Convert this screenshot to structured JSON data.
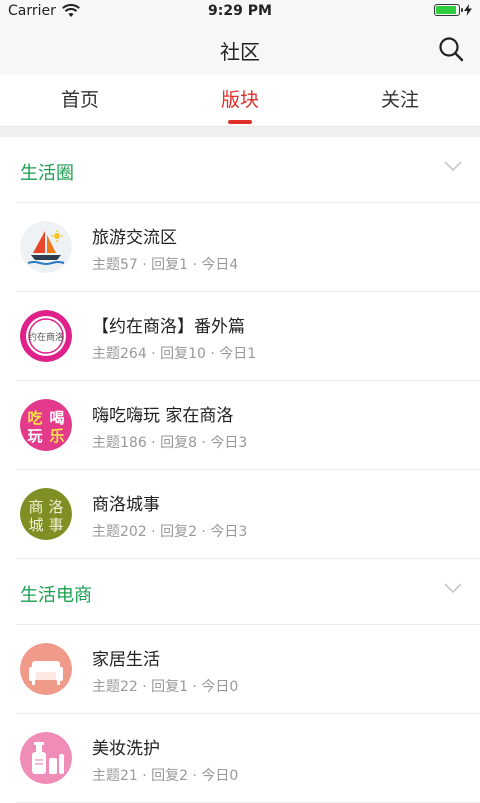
{
  "status_bar": {
    "carrier": "Carrier",
    "time": "9:29 PM",
    "battery_level": 1.0
  },
  "nav": {
    "title": "社区"
  },
  "tabs": [
    {
      "label": "首页",
      "active": false
    },
    {
      "label": "版块",
      "active": true
    },
    {
      "label": "关注",
      "active": false
    }
  ],
  "sections": [
    {
      "title": "生活圈",
      "items": [
        {
          "title": "旅游交流区",
          "meta": "主题57 · 回复1 · 今日4"
        },
        {
          "title": "【约在商洛】番外篇",
          "meta": "主题264 · 回复10 · 今日1"
        },
        {
          "title": "嗨吃嗨玩 家在商洛",
          "meta": "主题186 · 回复8 · 今日3"
        },
        {
          "title": "商洛城事",
          "meta": "主题202 · 回复2 · 今日3"
        }
      ]
    },
    {
      "title": "生活电商",
      "items": [
        {
          "title": "家居生活",
          "meta": "主题22 · 回复1 · 今日0"
        },
        {
          "title": "美妆洗护",
          "meta": "主题21 · 回复2 · 今日0"
        }
      ]
    }
  ],
  "avatar_text": {
    "yuezai": "约在商洛",
    "haichi": [
      "吃",
      "喝",
      "玩",
      "乐"
    ],
    "chengshi": [
      "商",
      "洛",
      "城",
      "事"
    ]
  },
  "colors": {
    "accent": "#e0302a",
    "section": "#1aa050",
    "meta": "#999999"
  }
}
